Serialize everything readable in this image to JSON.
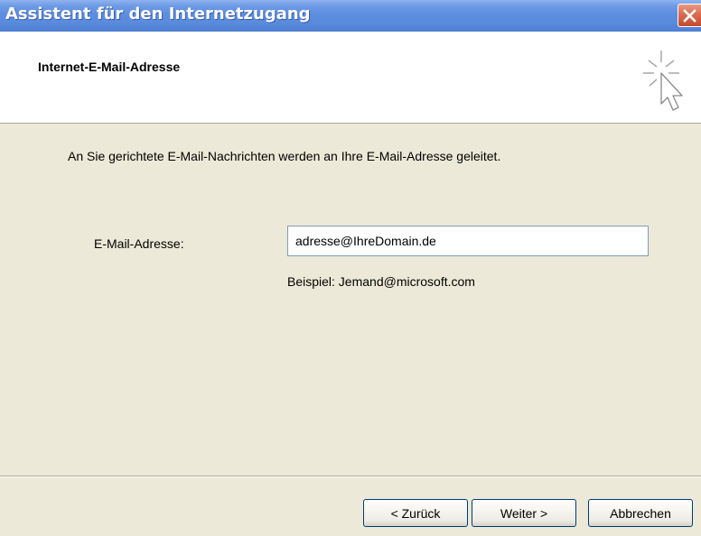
{
  "window": {
    "title": "Assistent für den Internetzugang",
    "close_icon": "close-icon",
    "close_color": "#d86d52",
    "titlebar_color": "#5a8bdc"
  },
  "header": {
    "title": "Internet-E-Mail-Adresse",
    "icon": "sparkle-cursor-icon"
  },
  "body": {
    "intro": "An Sie gerichtete E-Mail-Nachrichten werden an Ihre E-Mail-Adresse geleitet.",
    "email_label": "E-Mail-Adresse:",
    "email_value": "adresse@IhreDomain.de",
    "example": "Beispiel: Jemand@microsoft.com"
  },
  "buttons": {
    "back": "< Zurück",
    "next": "Weiter >",
    "cancel": "Abbrechen"
  }
}
